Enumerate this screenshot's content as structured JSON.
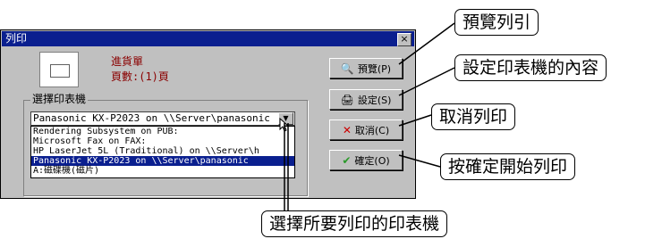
{
  "dialog": {
    "title": "列印",
    "close_glyph": "×",
    "document": {
      "name": "進貨單",
      "pages": "頁數:(1)頁"
    },
    "printer_group_label": "選擇印表機",
    "selected_printer": "Panasonic KX-P2023 on \\\\Server\\panasonic",
    "printer_options": [
      "Rendering Subsystem on PUB:",
      "Microsoft Fax on FAX:",
      "HP LaserJet 5L (Traditional) on \\\\Server\\h",
      "Panasonic KX-P2023 on \\\\Server\\panasonic",
      "A:磁碟機(磁片)"
    ],
    "selected_index": 3,
    "buttons": {
      "preview": "預覽(P)",
      "setup": "設定(S)",
      "cancel": "取消(C)",
      "ok": "確定(O)"
    }
  },
  "callouts": {
    "preview": "預覽列引",
    "setup": "設定印表機的內容",
    "cancel": "取消列印",
    "ok": "按確定開始列印",
    "select_printer": "選擇所要列印的印表機"
  },
  "colors": {
    "titlebar": "#0a1f8f",
    "doc_text": "#8a0000",
    "cancel_icon": "#cc0000",
    "ok_icon": "#2a9a2a"
  }
}
